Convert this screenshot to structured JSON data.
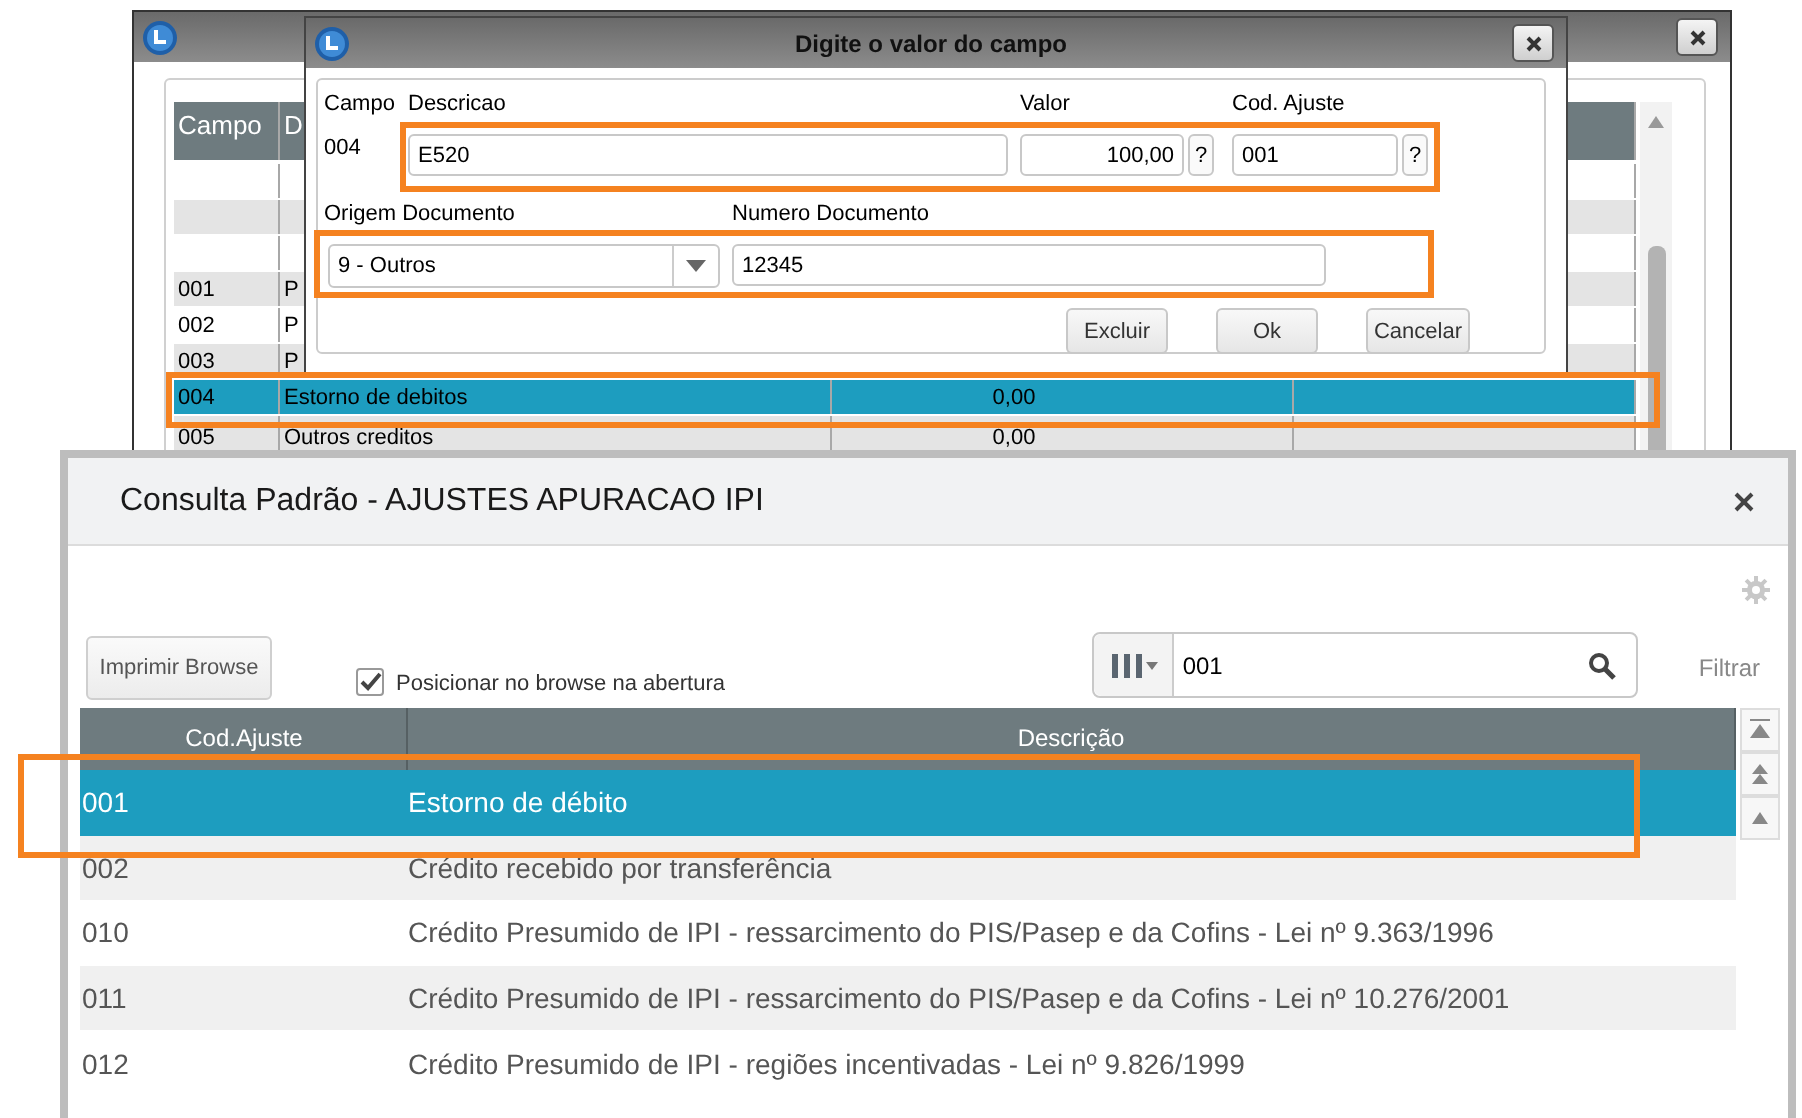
{
  "back_window": {
    "columns": [
      "Campo",
      "D"
    ],
    "rows": [
      {
        "selected": false
      },
      {
        "selected": false
      },
      {
        "selected": false
      },
      {
        "campo": "001",
        "descricao": "P",
        "selected": false
      },
      {
        "campo": "002",
        "descricao": "P",
        "selected": false
      },
      {
        "campo": "003",
        "descricao": "P",
        "selected": false
      },
      {
        "campo": "004",
        "descricao": "Estorno de debitos",
        "valor": "0,00",
        "selected": true
      },
      {
        "campo": "005",
        "descricao": "Outros creditos",
        "valor": "0,00",
        "selected": false
      }
    ]
  },
  "dialog": {
    "title": "Digite o valor do campo",
    "campo": {
      "label": "Campo",
      "value": "004"
    },
    "descricao": {
      "label": "Descricao",
      "value": "E520"
    },
    "valor": {
      "label": "Valor",
      "value": "100,00",
      "help": "?"
    },
    "cod_ajuste": {
      "label": "Cod. Ajuste",
      "value": "001",
      "help": "?"
    },
    "origem": {
      "label": "Origem Documento",
      "value": "9 - Outros"
    },
    "numero": {
      "label": "Numero Documento",
      "value": "12345"
    },
    "buttons": [
      "Excluir",
      "Ok",
      "Cancelar"
    ]
  },
  "consulta": {
    "title": "Consulta Padrão - AJUSTES APURACAO IPI",
    "print_button": "Imprimir Browse",
    "checkbox": {
      "label": "Posicionar no browse na abertura",
      "checked": true
    },
    "search": {
      "value": "001"
    },
    "filter_link": "Filtrar",
    "columns": [
      "Cod.Ajuste",
      "Descrição"
    ],
    "rows": [
      {
        "code": "001",
        "description": "Estorno de débito",
        "selected": true
      },
      {
        "code": "002",
        "description": "Crédito recebido por transferência",
        "selected": false
      },
      {
        "code": "010",
        "description": "Crédito Presumido de IPI - ressarcimento do PIS/Pasep e da Cofins - Lei nº 9.363/1996",
        "selected": false
      },
      {
        "code": "011",
        "description": "Crédito Presumido de IPI - ressarcimento do PIS/Pasep e da Cofins - Lei nº 10.276/2001",
        "selected": false
      },
      {
        "code": "012",
        "description": "Crédito Presumido de IPI - regiões incentivadas - Lei nº 9.826/1999",
        "selected": false
      }
    ]
  }
}
